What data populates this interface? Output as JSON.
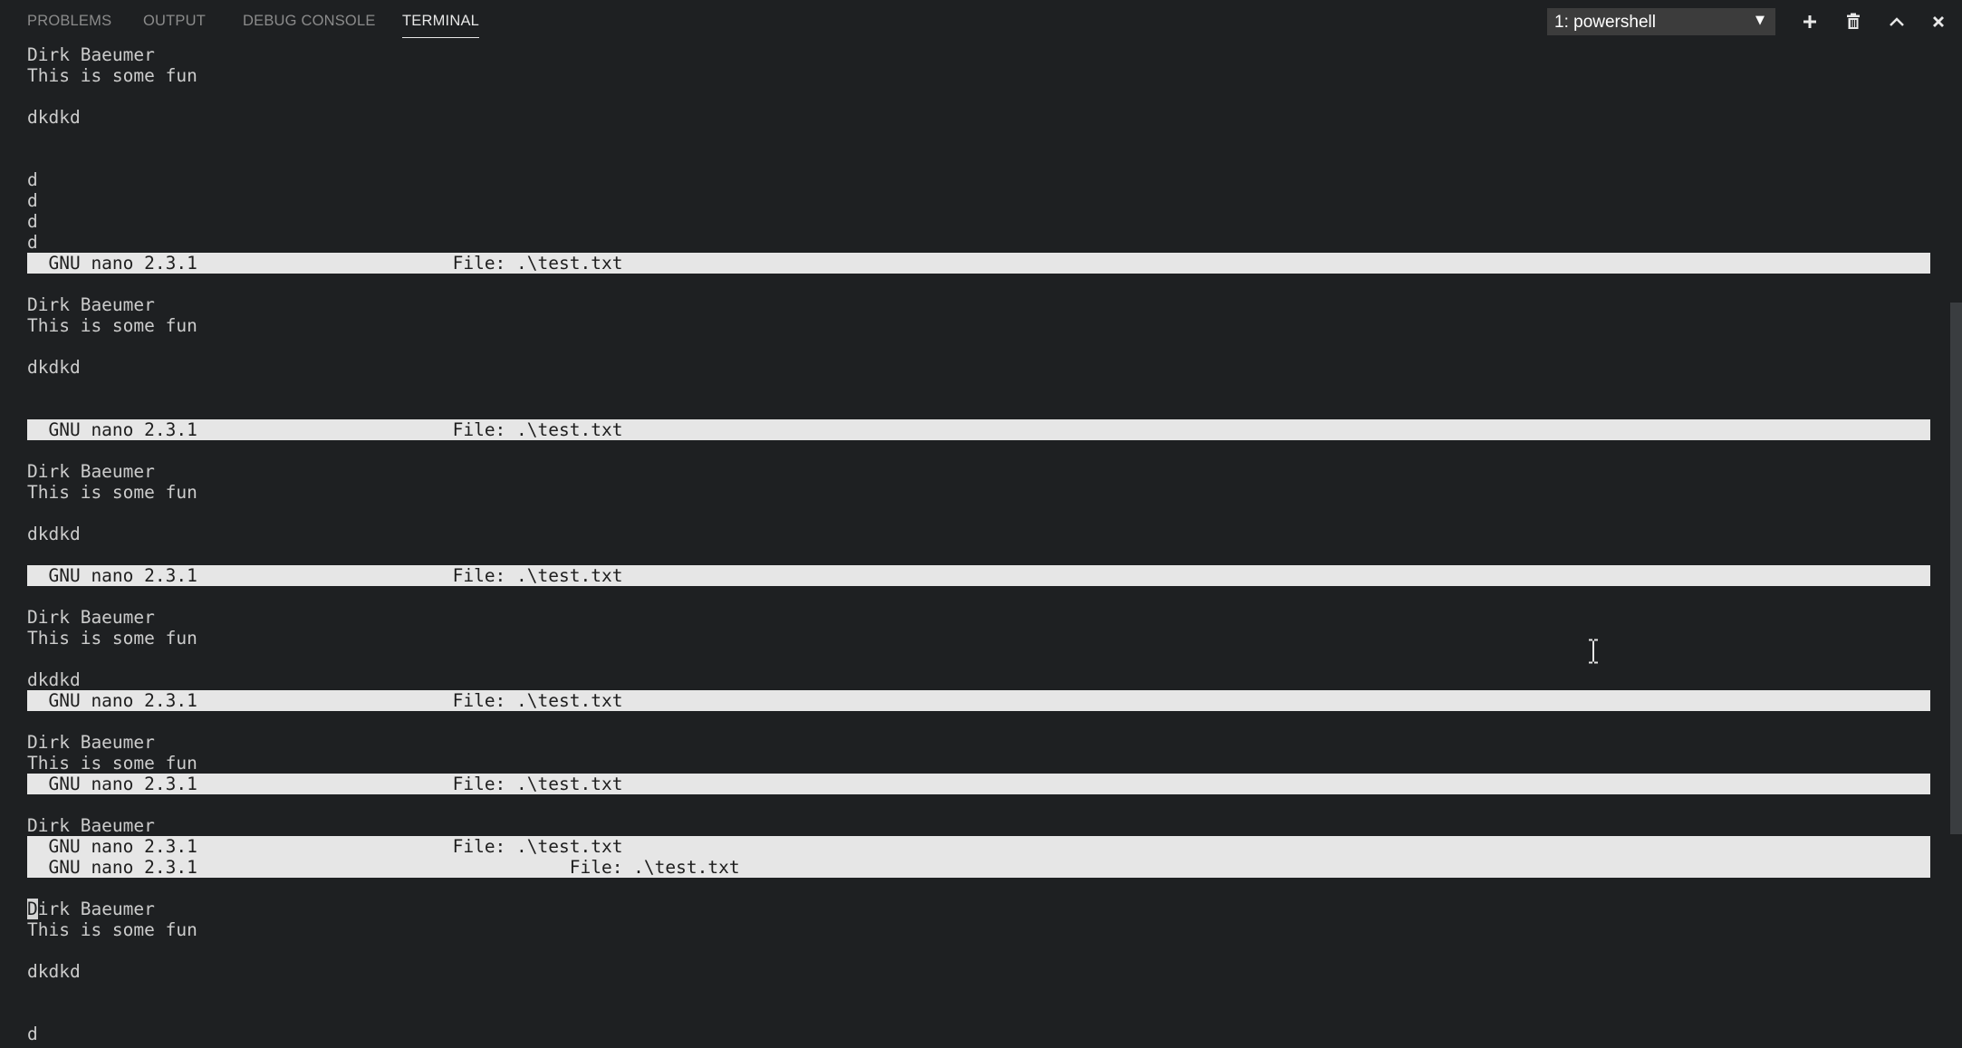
{
  "panel": {
    "tabs": [
      {
        "label": "PROBLEMS"
      },
      {
        "label": "OUTPUT"
      },
      {
        "label": "DEBUG CONSOLE"
      },
      {
        "label": "TERMINAL",
        "active": true
      }
    ],
    "terminal_selector": {
      "selected": "1: powershell"
    },
    "actions": [
      {
        "icon": "plus-icon",
        "label": "New Terminal"
      },
      {
        "icon": "trash-icon",
        "label": "Kill Terminal"
      },
      {
        "icon": "chevron-up-icon",
        "label": "Maximize Panel Size"
      },
      {
        "icon": "close-icon",
        "label": "Close Panel"
      }
    ]
  },
  "terminal": {
    "colors": {
      "background": "#1e2022",
      "foreground": "#cccccc",
      "nano_bar": "#e6e6e6",
      "nano_bar_text": "#1e1e1e"
    },
    "lines": [
      "Dirk Baeumer",
      "This is some fun",
      "",
      "dkdkd",
      "",
      "",
      "d",
      "d",
      "d",
      "d",
      "  GNU nano 2.3.1                        File: .\\test.txt",
      "",
      "Dirk Baeumer",
      "This is some fun",
      "",
      "dkdkd",
      "",
      "",
      "  GNU nano 2.3.1                        File: .\\test.txt",
      "",
      "Dirk Baeumer",
      "This is some fun",
      "",
      "dkdkd",
      "",
      "  GNU nano 2.3.1                        File: .\\test.txt",
      "",
      "Dirk Baeumer",
      "This is some fun",
      "",
      "dkdkd",
      "  GNU nano 2.3.1                        File: .\\test.txt",
      "",
      "Dirk Baeumer",
      "This is some fun",
      "  GNU nano 2.3.1                        File: .\\test.txt",
      "",
      "Dirk Baeumer",
      "  GNU nano 2.3.1                        File: .\\test.txt",
      "  GNU nano 2.3.1                                   File: .\\test.txt",
      "",
      "Dirk Baeumer",
      "This is some fun",
      "",
      "dkdkd",
      "",
      "",
      "d"
    ],
    "cursor": {
      "line": 41,
      "char": "D",
      "rest": "irk Baeumer"
    }
  }
}
